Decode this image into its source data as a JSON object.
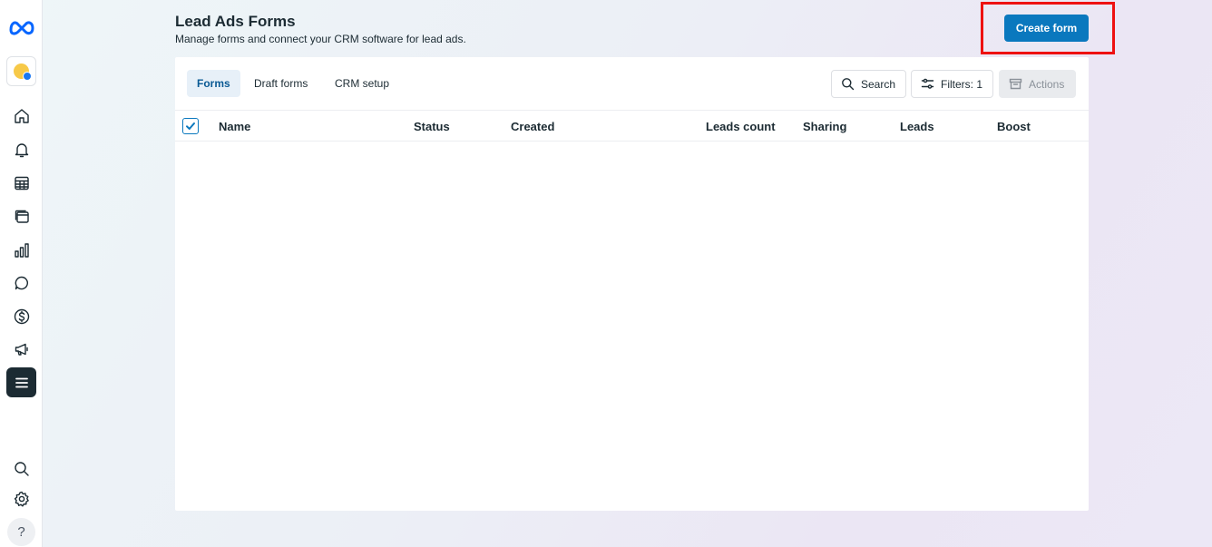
{
  "header": {
    "title": "Lead Ads Forms",
    "subtitle": "Manage forms and connect your CRM software for lead ads.",
    "create_button": "Create form"
  },
  "sidebar": {
    "items": [
      {
        "name": "home-icon"
      },
      {
        "name": "notifications-icon"
      },
      {
        "name": "table-icon"
      },
      {
        "name": "pages-icon"
      },
      {
        "name": "insights-icon"
      },
      {
        "name": "messages-icon"
      },
      {
        "name": "billing-icon"
      },
      {
        "name": "ads-icon"
      },
      {
        "name": "all-tools-menu-icon"
      }
    ],
    "bottom": [
      {
        "name": "search-icon"
      },
      {
        "name": "settings-icon"
      },
      {
        "name": "help-icon",
        "glyph": "?"
      }
    ]
  },
  "tabs": [
    {
      "label": "Forms",
      "active": true
    },
    {
      "label": "Draft forms",
      "active": false
    },
    {
      "label": "CRM setup",
      "active": false
    }
  ],
  "toolbar": {
    "search_label": "Search",
    "filters_label": "Filters: 1",
    "actions_label": "Actions"
  },
  "table": {
    "columns": [
      "Name",
      "Status",
      "Created",
      "Leads count",
      "Sharing",
      "Leads",
      "Boost"
    ],
    "rows": []
  },
  "colors": {
    "primary": "#0a78be",
    "highlight": "#ee1111",
    "text": "#1c2b33"
  }
}
